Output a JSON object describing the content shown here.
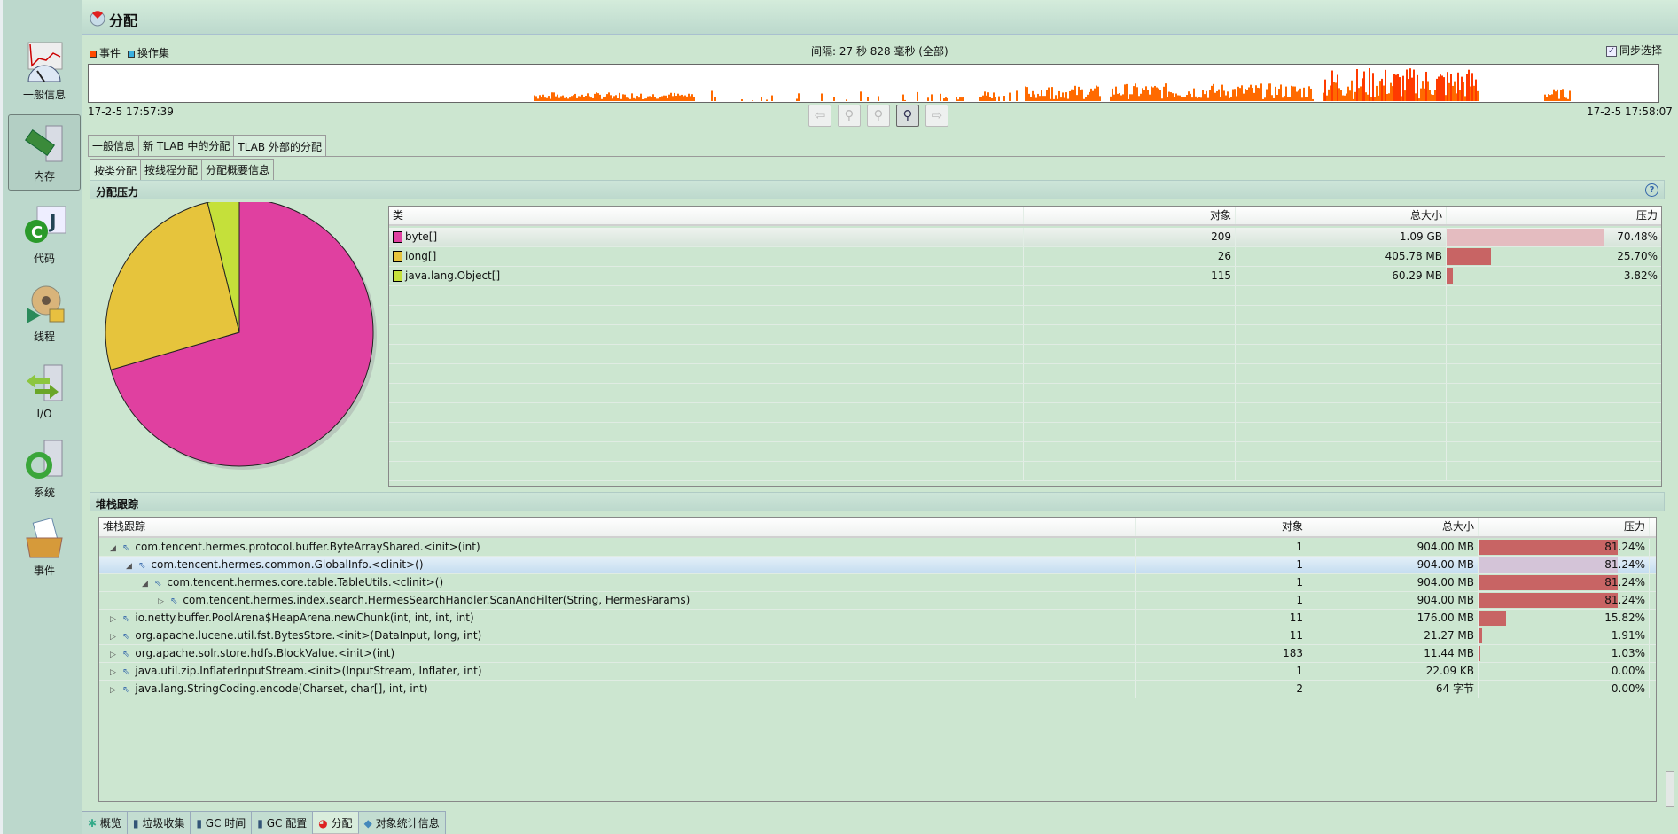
{
  "sidebar": {
    "items": [
      {
        "label": "一般信息"
      },
      {
        "label": "内存"
      },
      {
        "label": "代码"
      },
      {
        "label": "线程"
      },
      {
        "label": "I/O"
      },
      {
        "label": "系统"
      },
      {
        "label": "事件"
      }
    ]
  },
  "header": {
    "title": "分配"
  },
  "timeline": {
    "legend_events": "事件",
    "legend_ops": "操作集",
    "interval": "间隔: 27 秒 828 毫秒 (全部)",
    "sync_label": "同步选择",
    "sync_checked": true,
    "start": "17-2-5 17:57:39",
    "end": "17-2-5 17:58:07",
    "event_color": "#ff6a00",
    "ops_color": "#3ab0e0"
  },
  "tabs": [
    "一般信息",
    "新 TLAB 中的分配",
    "TLAB 外部的分配"
  ],
  "subtabs": [
    "按类分配",
    "按线程分配",
    "分配概要信息"
  ],
  "pressure": {
    "title": "分配压力",
    "help": "?",
    "columns": [
      "类",
      "对象",
      "总大小",
      "压力"
    ],
    "rows": [
      {
        "name": "byte[]",
        "objects": "209",
        "size": "1.09 GB",
        "pressure": "70.48%",
        "pct": 70.48,
        "color": "#e040a0"
      },
      {
        "name": "long[]",
        "objects": "26",
        "size": "405.78 MB",
        "pressure": "25.70%",
        "pct": 25.7,
        "color": "#e6c43c"
      },
      {
        "name": "java.lang.Object[]",
        "objects": "115",
        "size": "60.29 MB",
        "pressure": "3.82%",
        "pct": 3.82,
        "color": "#c5e03a"
      }
    ]
  },
  "stack": {
    "title": "堆栈跟踪",
    "columns": [
      "堆栈跟踪",
      "对象",
      "总大小",
      "压力"
    ],
    "rows": [
      {
        "depth": 0,
        "open": true,
        "name": "com.tencent.hermes.protocol.buffer.ByteArrayShared.<init>(int)",
        "objects": "1",
        "size": "904.00 MB",
        "pressure": "81.24%",
        "pct": 81.24
      },
      {
        "depth": 1,
        "open": true,
        "sel": true,
        "name": "com.tencent.hermes.common.GlobalInfo.<clinit>()",
        "objects": "1",
        "size": "904.00 MB",
        "pressure": "81.24%",
        "pct": 81.24
      },
      {
        "depth": 2,
        "open": true,
        "name": "com.tencent.hermes.core.table.TableUtils.<clinit>()",
        "objects": "1",
        "size": "904.00 MB",
        "pressure": "81.24%",
        "pct": 81.24
      },
      {
        "depth": 3,
        "open": false,
        "name": "com.tencent.hermes.index.search.HermesSearchHandler.ScanAndFilter(String, HermesParams)",
        "objects": "1",
        "size": "904.00 MB",
        "pressure": "81.24%",
        "pct": 81.24
      },
      {
        "depth": 0,
        "open": false,
        "name": "io.netty.buffer.PoolArena$HeapArena.newChunk(int, int, int, int)",
        "objects": "11",
        "size": "176.00 MB",
        "pressure": "15.82%",
        "pct": 15.82
      },
      {
        "depth": 0,
        "open": false,
        "name": "org.apache.lucene.util.fst.BytesStore.<init>(DataInput, long, int)",
        "objects": "11",
        "size": "21.27 MB",
        "pressure": "1.91%",
        "pct": 1.91
      },
      {
        "depth": 0,
        "open": false,
        "name": "org.apache.solr.store.hdfs.BlockValue.<init>(int)",
        "objects": "183",
        "size": "11.44 MB",
        "pressure": "1.03%",
        "pct": 1.03
      },
      {
        "depth": 0,
        "open": false,
        "name": "java.util.zip.InflaterInputStream.<init>(InputStream, Inflater, int)",
        "objects": "1",
        "size": "22.09 KB",
        "pressure": "0.00%",
        "pct": 0
      },
      {
        "depth": 0,
        "open": false,
        "name": "java.lang.StringCoding.encode(Charset, char[], int, int)",
        "objects": "2",
        "size": "64 字节",
        "pressure": "0.00%",
        "pct": 0
      }
    ]
  },
  "bottom_tabs": [
    "概览",
    "垃圾收集",
    "GC 时间",
    "GC 配置",
    "分配",
    "对象统计信息"
  ],
  "bar_color": "#c86464"
}
